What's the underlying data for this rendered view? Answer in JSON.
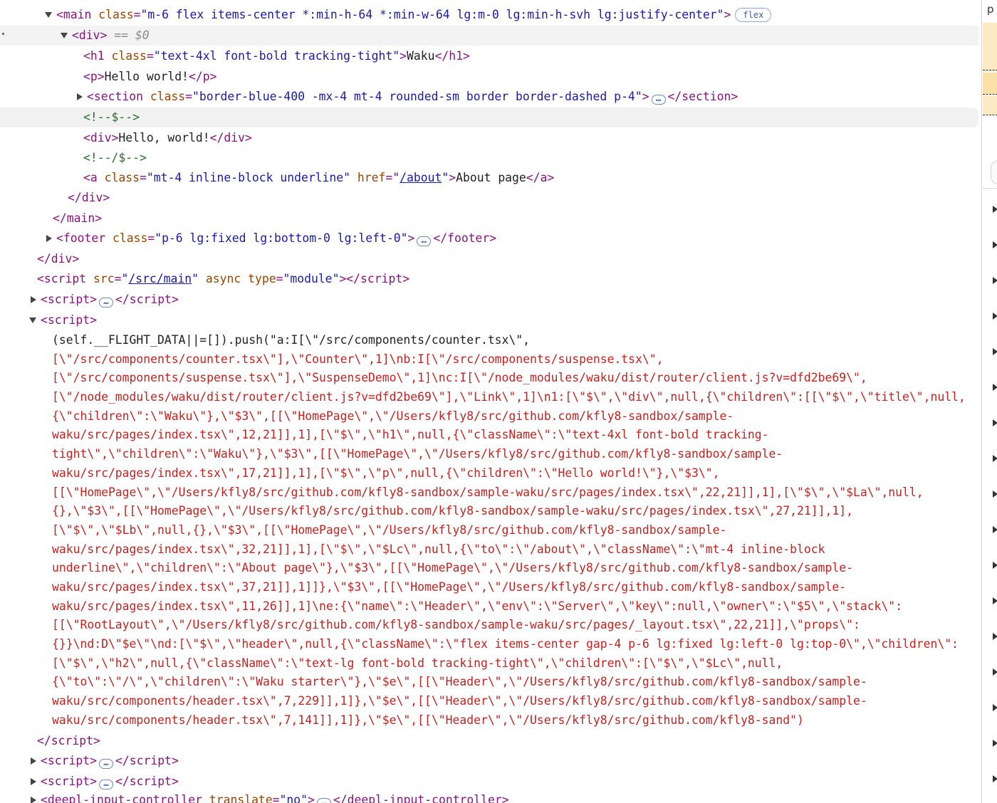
{
  "tree": {
    "main_tag": "main",
    "main_class": "m-6 flex items-center *:min-h-64 *:min-w-64 lg:m-0 lg:min-h-svh lg:justify-center",
    "main_badge": "flex",
    "div_tag": "div",
    "selected_marker": "== $0",
    "h1_tag": "h1",
    "h1_class": "text-4xl font-bold tracking-tight",
    "h1_text": "Waku",
    "p_tag": "p",
    "p_text": "Hello world!",
    "section_tag": "section",
    "section_class": "border-blue-400 -mx-4 mt-4 rounded-sm border border-dashed p-4",
    "comment_open": "<!--$-->",
    "inner_div_text": "Hello, world!",
    "comment_close": "<!--/$-->",
    "a_tag": "a",
    "a_class": "mt-4 inline-block underline",
    "a_href": "/about",
    "a_text": "About page",
    "footer_tag": "footer",
    "footer_class": "p-6 lg:fixed lg:bottom-0 lg:left-0",
    "script_tag": "script",
    "script_src": "/src/main",
    "script_type": "module",
    "attr_class": "class",
    "attr_href": "href",
    "attr_src": "src",
    "attr_async": "async",
    "attr_type": "type",
    "attr_translate": "translate",
    "deepl_tag": "deepl-input-controller",
    "deepl_translate": "no",
    "ellipsis": "…"
  },
  "script_lines": [
    "(self.__FLIGHT_DATA||=[]).push(\"a:I[\\\"/src/components/counter.tsx\\\",",
    "[\\\"/src/components/counter.tsx\\\"],\\\"Counter\\\",1]\\nb:I[\\\"/src/components/suspense.tsx\\\",",
    "[\\\"/src/components/suspense.tsx\\\"],\\\"SuspenseDemo\\\",1]\\nc:I[\\\"/node_modules/waku/dist/router/client.js?v=dfd2be69\\\",",
    "[\\\"/node_modules/waku/dist/router/client.js?v=dfd2be69\\\"],\\\"Link\\\",1]\\n1:[\\\"$\\\",\\\"div\\\",null,{\\\"children\\\":[[\\\"$\\\",\\\"title\\\",null,",
    "{\\\"children\\\":\\\"Waku\\\"},\\\"$3\\\",[[\\\"HomePage\\\",\\\"/Users/kfly8/src/github.com/kfly8-sandbox/sample-",
    "waku/src/pages/index.tsx\\\",12,21]],1],[\\\"$\\\",\\\"h1\\\",null,{\\\"className\\\":\\\"text-4xl font-bold tracking-",
    "tight\\\",\\\"children\\\":\\\"Waku\\\"},\\\"$3\\\",[[\\\"HomePage\\\",\\\"/Users/kfly8/src/github.com/kfly8-sandbox/sample-",
    "waku/src/pages/index.tsx\\\",17,21]],1],[\\\"$\\\",\\\"p\\\",null,{\\\"children\\\":\\\"Hello world!\\\"},\\\"$3\\\",",
    "[[\\\"HomePage\\\",\\\"/Users/kfly8/src/github.com/kfly8-sandbox/sample-waku/src/pages/index.tsx\\\",22,21]],1],[\\\"$\\\",\\\"$La\\\",null,",
    "{},\\\"$3\\\",[[\\\"HomePage\\\",\\\"/Users/kfly8/src/github.com/kfly8-sandbox/sample-waku/src/pages/index.tsx\\\",27,21]],1],",
    "[\\\"$\\\",\\\"$Lb\\\",null,{},\\\"$3\\\",[[\\\"HomePage\\\",\\\"/Users/kfly8/src/github.com/kfly8-sandbox/sample-",
    "waku/src/pages/index.tsx\\\",32,21]],1],[\\\"$\\\",\\\"$Lc\\\",null,{\\\"to\\\":\\\"/about\\\",\\\"className\\\":\\\"mt-4 inline-block",
    "underline\\\",\\\"children\\\":\\\"About page\\\"},\\\"$3\\\",[[\\\"HomePage\\\",\\\"/Users/kfly8/src/github.com/kfly8-sandbox/sample-",
    "waku/src/pages/index.tsx\\\",37,21]],1]]},\\\"$3\\\",[[\\\"HomePage\\\",\\\"/Users/kfly8/src/github.com/kfly8-sandbox/sample-",
    "waku/src/pages/index.tsx\\\",11,26]],1]\\ne:{\\\"name\\\":\\\"Header\\\",\\\"env\\\":\\\"Server\\\",\\\"key\\\":null,\\\"owner\\\":\\\"$5\\\",\\\"stack\\\":",
    "[[\\\"RootLayout\\\",\\\"/Users/kfly8/src/github.com/kfly8-sandbox/sample-waku/src/pages/_layout.tsx\\\",22,21]],\\\"props\\\":",
    "{}}\\nd:D\\\"$e\\\"\\nd:[\\\"$\\\",\\\"header\\\",null,{\\\"className\\\":\\\"flex items-center gap-4 p-6 lg:fixed lg:left-0 lg:top-0\\\",\\\"children\\\":",
    "[\\\"$\\\",\\\"h2\\\",null,{\\\"className\\\":\\\"text-lg font-bold tracking-tight\\\",\\\"children\\\":[\\\"$\\\",\\\"$Lc\\\",null,",
    "{\\\"to\\\":\\\"/\\\",\\\"children\\\":\\\"Waku starter\\\"},\\\"$e\\\",[[\\\"Header\\\",\\\"/Users/kfly8/src/github.com/kfly8-sandbox/sample-",
    "waku/src/components/header.tsx\\\",7,229]],1]},\\\"$e\\\",[[\\\"Header\\\",\\\"/Users/kfly8/src/github.com/kfly8-sandbox/sample-",
    "waku/src/components/header.tsx\\\",7,141]],1]},\\\"$e\\\",[[\\\"Header\\\",\\\"/Users/kfly8/src/github.com/kfly8-sand\")"
  ],
  "sidebar": {
    "letter": "p",
    "accent_color": "#fde9c4",
    "accent_color_2": "#fbe0a8"
  },
  "colors": {
    "tag": "#881280",
    "attr_name": "#994500",
    "attr_value": "#1a1aa6",
    "comment": "#236e25",
    "script_text": "#c5221f"
  }
}
